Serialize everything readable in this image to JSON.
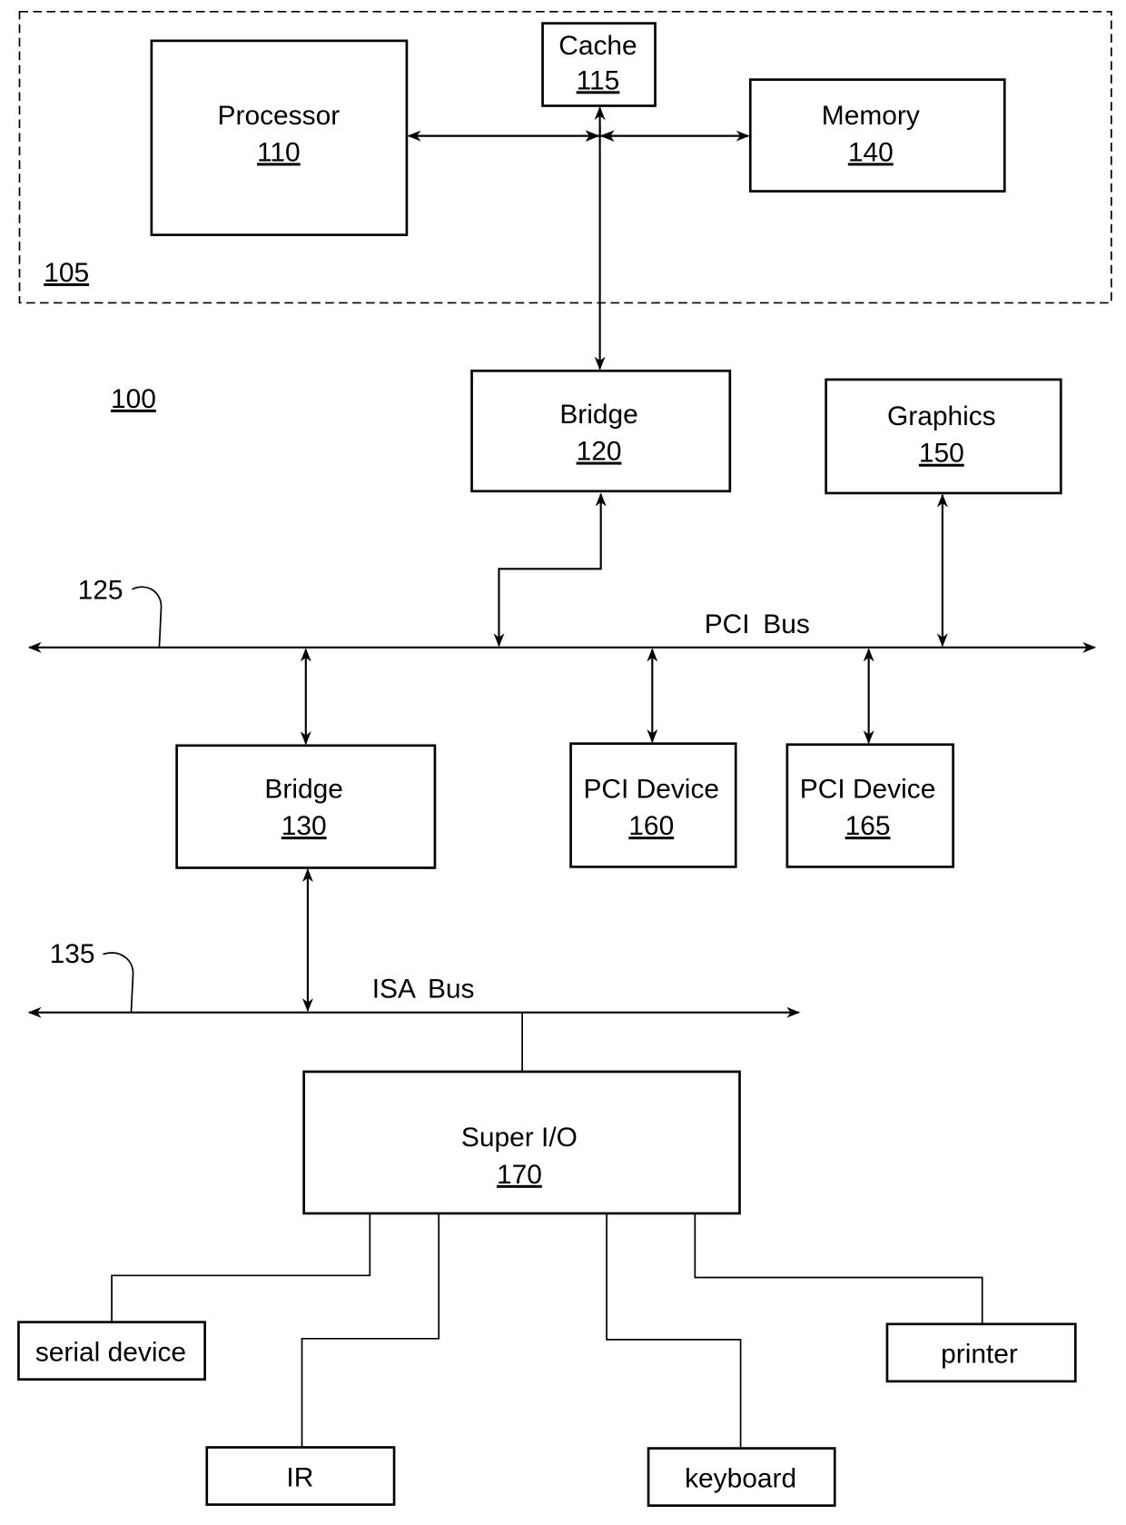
{
  "figure": {
    "system_ref": "100",
    "subsystem_ref": "105"
  },
  "blocks": {
    "processor": {
      "label": "Processor",
      "ref": "110"
    },
    "cache": {
      "label": "Cache",
      "ref": "115"
    },
    "memory": {
      "label": "Memory",
      "ref": "140"
    },
    "bridge_120": {
      "label": "Bridge",
      "ref": "120"
    },
    "graphics": {
      "label": "Graphics",
      "ref": "150"
    },
    "bridge_130": {
      "label": "Bridge",
      "ref": "130"
    },
    "pci_device_160": {
      "label": "PCI Device",
      "ref": "160"
    },
    "pci_device_165": {
      "label": "PCI Device",
      "ref": "165"
    },
    "super_io": {
      "label": "Super I/O",
      "ref": "170"
    },
    "serial_device": {
      "label": "serial device"
    },
    "ir": {
      "label": "IR"
    },
    "keyboard": {
      "label": "keyboard"
    },
    "printer": {
      "label": "printer"
    }
  },
  "buses": {
    "pci": {
      "label": "PCI Bus",
      "ref": "125"
    },
    "isa": {
      "label": "ISA Bus",
      "ref": "135"
    }
  }
}
